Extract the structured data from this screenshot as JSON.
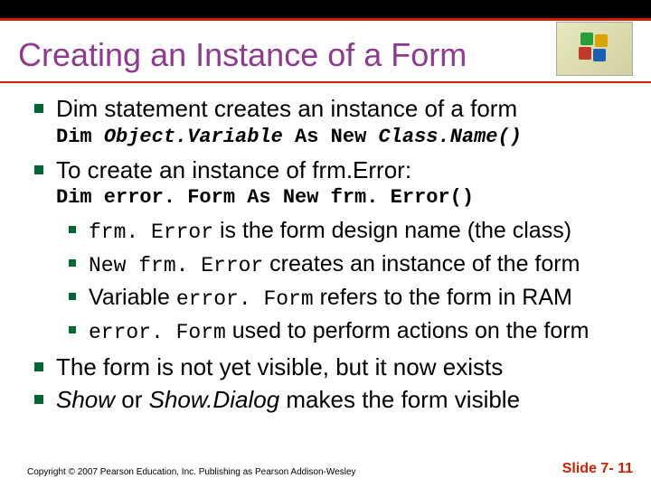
{
  "title": "Creating an Instance of a Form",
  "bullets": {
    "b1": "Dim statement creates an instance of a form",
    "code1_pre": "Dim ",
    "code1_var": "Object.Variable",
    "code1_mid": " As New ",
    "code1_cls": "Class.Name()",
    "b2": "To create an instance of frm.Error:",
    "code2": "Dim error. Form As New frm. Error()",
    "sub1_code": "frm. Error",
    "sub1_rest": " is the form design name (the class)",
    "sub2_code": "New frm. Error",
    "sub2_rest": " creates an instance of the form",
    "sub3_pre": "Variable ",
    "sub3_code": "error. Form",
    "sub3_rest": " refers to the form in RAM",
    "sub4_code": "error. Form",
    "sub4_rest": " used to perform actions on the form",
    "b3": "The form is not yet visible, but it now exists",
    "b4_pre": "",
    "b4_i1": "Show",
    "b4_mid": " or ",
    "b4_i2": "Show.Dialog",
    "b4_rest": " makes the form visible"
  },
  "footer": {
    "copyright": "Copyright © 2007 Pearson Education, Inc. Publishing as Pearson Addison-Wesley",
    "slide": "Slide 7- 11"
  }
}
